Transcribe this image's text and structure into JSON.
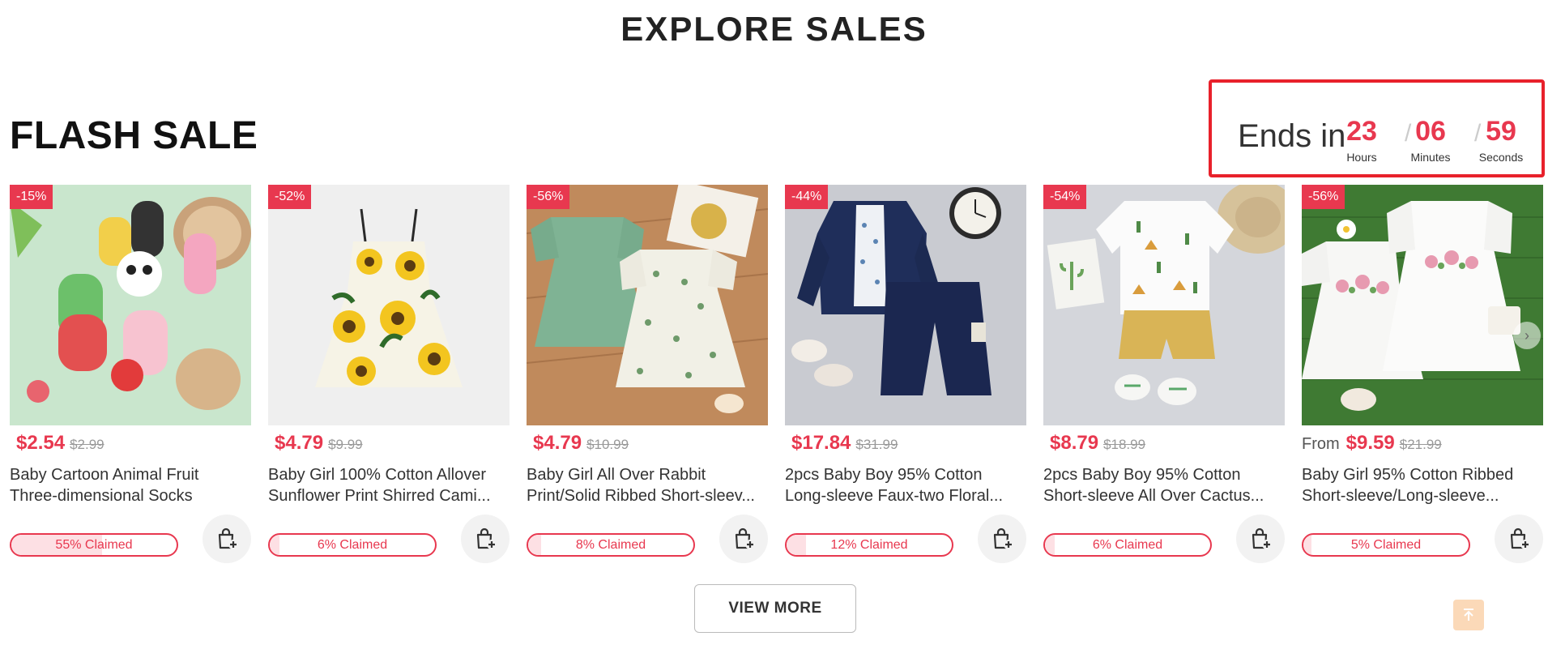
{
  "header": {
    "title": "EXPLORE SALES"
  },
  "flash_sale": {
    "title": "FLASH SALE",
    "countdown": {
      "label": "Ends in",
      "hours": "23",
      "hours_label": "Hours",
      "minutes": "06",
      "minutes_label": "Minutes",
      "seconds": "59",
      "seconds_label": "Seconds",
      "separator": "/"
    }
  },
  "products": [
    {
      "discount": "-15%",
      "from": "",
      "price": "$2.54",
      "original_price": "$2.99",
      "name_line1": "Baby Cartoon Animal Fruit",
      "name_line2": "Three-dimensional Socks",
      "claimed": "55% Claimed",
      "claimed_pct": 55
    },
    {
      "discount": "-52%",
      "from": "",
      "price": "$4.79",
      "original_price": "$9.99",
      "name_line1": "Baby Girl 100% Cotton Allover",
      "name_line2": "Sunflower Print Shirred Cami...",
      "claimed": "6% Claimed",
      "claimed_pct": 6
    },
    {
      "discount": "-56%",
      "from": "",
      "price": "$4.79",
      "original_price": "$10.99",
      "name_line1": "Baby Girl All Over Rabbit",
      "name_line2": "Print/Solid Ribbed Short-sleev...",
      "claimed": "8% Claimed",
      "claimed_pct": 8
    },
    {
      "discount": "-44%",
      "from": "",
      "price": "$17.84",
      "original_price": "$31.99",
      "name_line1": "2pcs Baby Boy 95% Cotton",
      "name_line2": "Long-sleeve Faux-two Floral...",
      "claimed": "12% Claimed",
      "claimed_pct": 12
    },
    {
      "discount": "-54%",
      "from": "",
      "price": "$8.79",
      "original_price": "$18.99",
      "name_line1": "2pcs Baby Boy 95% Cotton",
      "name_line2": "Short-sleeve All Over Cactus...",
      "claimed": "6% Claimed",
      "claimed_pct": 6
    },
    {
      "discount": "-56%",
      "from": "From",
      "price": "$9.59",
      "original_price": "$21.99",
      "name_line1": "Baby Girl 95% Cotton Ribbed",
      "name_line2": "Short-sleeve/Long-sleeve...",
      "claimed": "5% Claimed",
      "claimed_pct": 5
    }
  ],
  "actions": {
    "view_more": "VIEW MORE"
  },
  "icons": {
    "cart": "add-to-cart-icon",
    "back_to_top": "arrow-up-icon",
    "carousel_next": "chevron-right-icon"
  },
  "colors": {
    "accent": "#e8384f",
    "highlight_box": "#e8212b",
    "back_to_top_bg": "#fbd9b8"
  }
}
